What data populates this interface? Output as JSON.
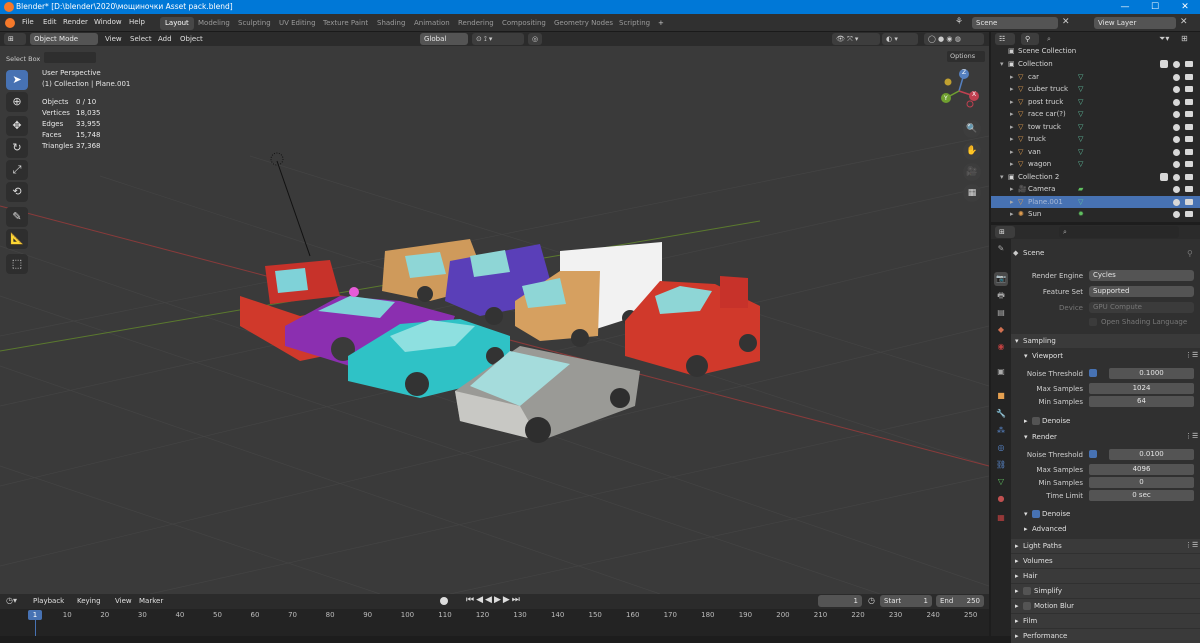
{
  "titlebar": {
    "title": "Blender* [D:\\blender\\2020\\мощиночки Asset pack.blend]",
    "min": "—",
    "max": "☐",
    "close": "✕"
  },
  "menus": [
    "File",
    "Edit",
    "Render",
    "Window",
    "Help"
  ],
  "workspaces": [
    "Layout",
    "Modeling",
    "Sculpting",
    "UV Editing",
    "Texture Paint",
    "Shading",
    "Animation",
    "Rendering",
    "Compositing",
    "Geometry Nodes",
    "Scripting"
  ],
  "add_workspace": "+",
  "scene": {
    "label": "Scene",
    "view_layer": "View Layer"
  },
  "vp_header": {
    "mode": "Object Mode",
    "menus": [
      "View",
      "Select",
      "Add",
      "Object"
    ],
    "orientation": "Global",
    "select_box": "Select Box",
    "options": "Options"
  },
  "overlay": {
    "title": "User Perspective",
    "subtitle": "(1) Collection | Plane.001",
    "stats": [
      {
        "label": "Objects",
        "value": "0 / 10"
      },
      {
        "label": "Vertices",
        "value": "18,035"
      },
      {
        "label": "Edges",
        "value": "33,955"
      },
      {
        "label": "Faces",
        "value": "15,748"
      },
      {
        "label": "Triangles",
        "value": "37,368"
      }
    ]
  },
  "gizmo": {
    "z": "Z",
    "x": "X",
    "y": "Y"
  },
  "outliner": {
    "root": "Scene Collection",
    "rows": [
      {
        "name": "Collection",
        "level": 1,
        "type": "collection"
      },
      {
        "name": "car",
        "level": 2,
        "type": "mesh"
      },
      {
        "name": "cuber truck",
        "level": 2,
        "type": "mesh"
      },
      {
        "name": "post truck",
        "level": 2,
        "type": "mesh"
      },
      {
        "name": "race car(?)",
        "level": 2,
        "type": "mesh"
      },
      {
        "name": "tow truck",
        "level": 2,
        "type": "mesh"
      },
      {
        "name": "truck",
        "level": 2,
        "type": "mesh"
      },
      {
        "name": "van",
        "level": 2,
        "type": "mesh"
      },
      {
        "name": "wagon",
        "level": 2,
        "type": "mesh"
      },
      {
        "name": "Collection 2",
        "level": 1,
        "type": "collection"
      },
      {
        "name": "Camera",
        "level": 2,
        "type": "camera"
      },
      {
        "name": "Plane.001",
        "level": 2,
        "type": "mesh",
        "selected": true
      },
      {
        "name": "Sun",
        "level": 2,
        "type": "light"
      }
    ]
  },
  "props": {
    "breadcrumb": "Scene",
    "render_engine": {
      "label": "Render Engine",
      "value": "Cycles"
    },
    "feature_set": {
      "label": "Feature Set",
      "value": "Supported"
    },
    "device": {
      "label": "Device",
      "value": "GPU Compute"
    },
    "osl": "Open Shading Language",
    "sampling": "Sampling",
    "viewport": "Viewport",
    "vp_noise": {
      "label": "Noise Threshold",
      "value": "0.1000"
    },
    "vp_max": {
      "label": "Max Samples",
      "value": "1024"
    },
    "vp_min": {
      "label": "Min Samples",
      "value": "64"
    },
    "denoise": "Denoise",
    "render": "Render",
    "r_noise": {
      "label": "Noise Threshold",
      "value": "0.0100"
    },
    "r_max": {
      "label": "Max Samples",
      "value": "4096"
    },
    "r_min": {
      "label": "Min Samples",
      "value": "0"
    },
    "r_time": {
      "label": "Time Limit",
      "value": "0 sec"
    },
    "r_denoise": "Denoise",
    "advanced": "Advanced",
    "panels": [
      "Light Paths",
      "Volumes",
      "Hair",
      "Simplify",
      "Motion Blur",
      "Film",
      "Performance"
    ]
  },
  "timeline": {
    "menus": [
      "Playback",
      "Keying",
      "View",
      "Marker"
    ],
    "current_frame": "1",
    "start_label": "Start",
    "start": "1",
    "end_label": "End",
    "end": "250",
    "ticks": [
      "1",
      "10",
      "20",
      "30",
      "40",
      "50",
      "60",
      "70",
      "80",
      "90",
      "100",
      "110",
      "120",
      "130",
      "140",
      "150",
      "160",
      "170",
      "180",
      "190",
      "200",
      "210",
      "220",
      "230",
      "240",
      "250"
    ],
    "cursor": "1"
  },
  "colors": {
    "accent": "#4772b3",
    "mesh_icon": "#e5a050",
    "collection_icon": "#d8d8d8",
    "viewport_bg": "#3a3a3a"
  }
}
